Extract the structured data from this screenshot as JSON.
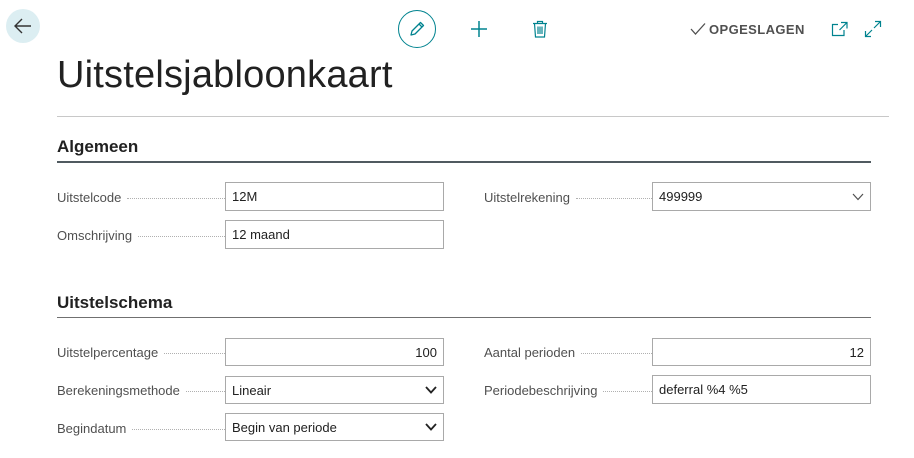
{
  "header": {
    "status_text": "OPGESLAGEN",
    "icons": {
      "back": "arrow-left-icon",
      "edit": "pencil-icon",
      "new": "plus-icon",
      "delete": "trash-icon",
      "saved": "checkmark-icon",
      "popout": "open-in-new-window-icon",
      "expand": "expand-icon"
    }
  },
  "page": {
    "title": "Uitstelsjabloonkaart"
  },
  "sections": {
    "general": {
      "title": "Algemeen",
      "fields": {
        "deferral_code": {
          "label": "Uitstelcode",
          "value": "12M"
        },
        "description": {
          "label": "Omschrijving",
          "value": "12 maand"
        },
        "deferral_account": {
          "label": "Uitstelrekening",
          "value": "499999"
        }
      }
    },
    "schedule": {
      "title": "Uitstelschema",
      "fields": {
        "deferral_pct": {
          "label": "Uitstelpercentage",
          "value": "100"
        },
        "calc_method": {
          "label": "Berekeningsmethode",
          "value": "Lineair"
        },
        "start_date": {
          "label": "Begindatum",
          "value": "Begin van periode"
        },
        "num_periods": {
          "label": "Aantal perioden",
          "value": "12"
        },
        "period_desc": {
          "label": "Periodebeschrijving",
          "value": "deferral %4 %5"
        }
      }
    }
  },
  "colors": {
    "accent": "#00838f",
    "back_bg": "#dceef2",
    "section_rule": "#505a60"
  }
}
